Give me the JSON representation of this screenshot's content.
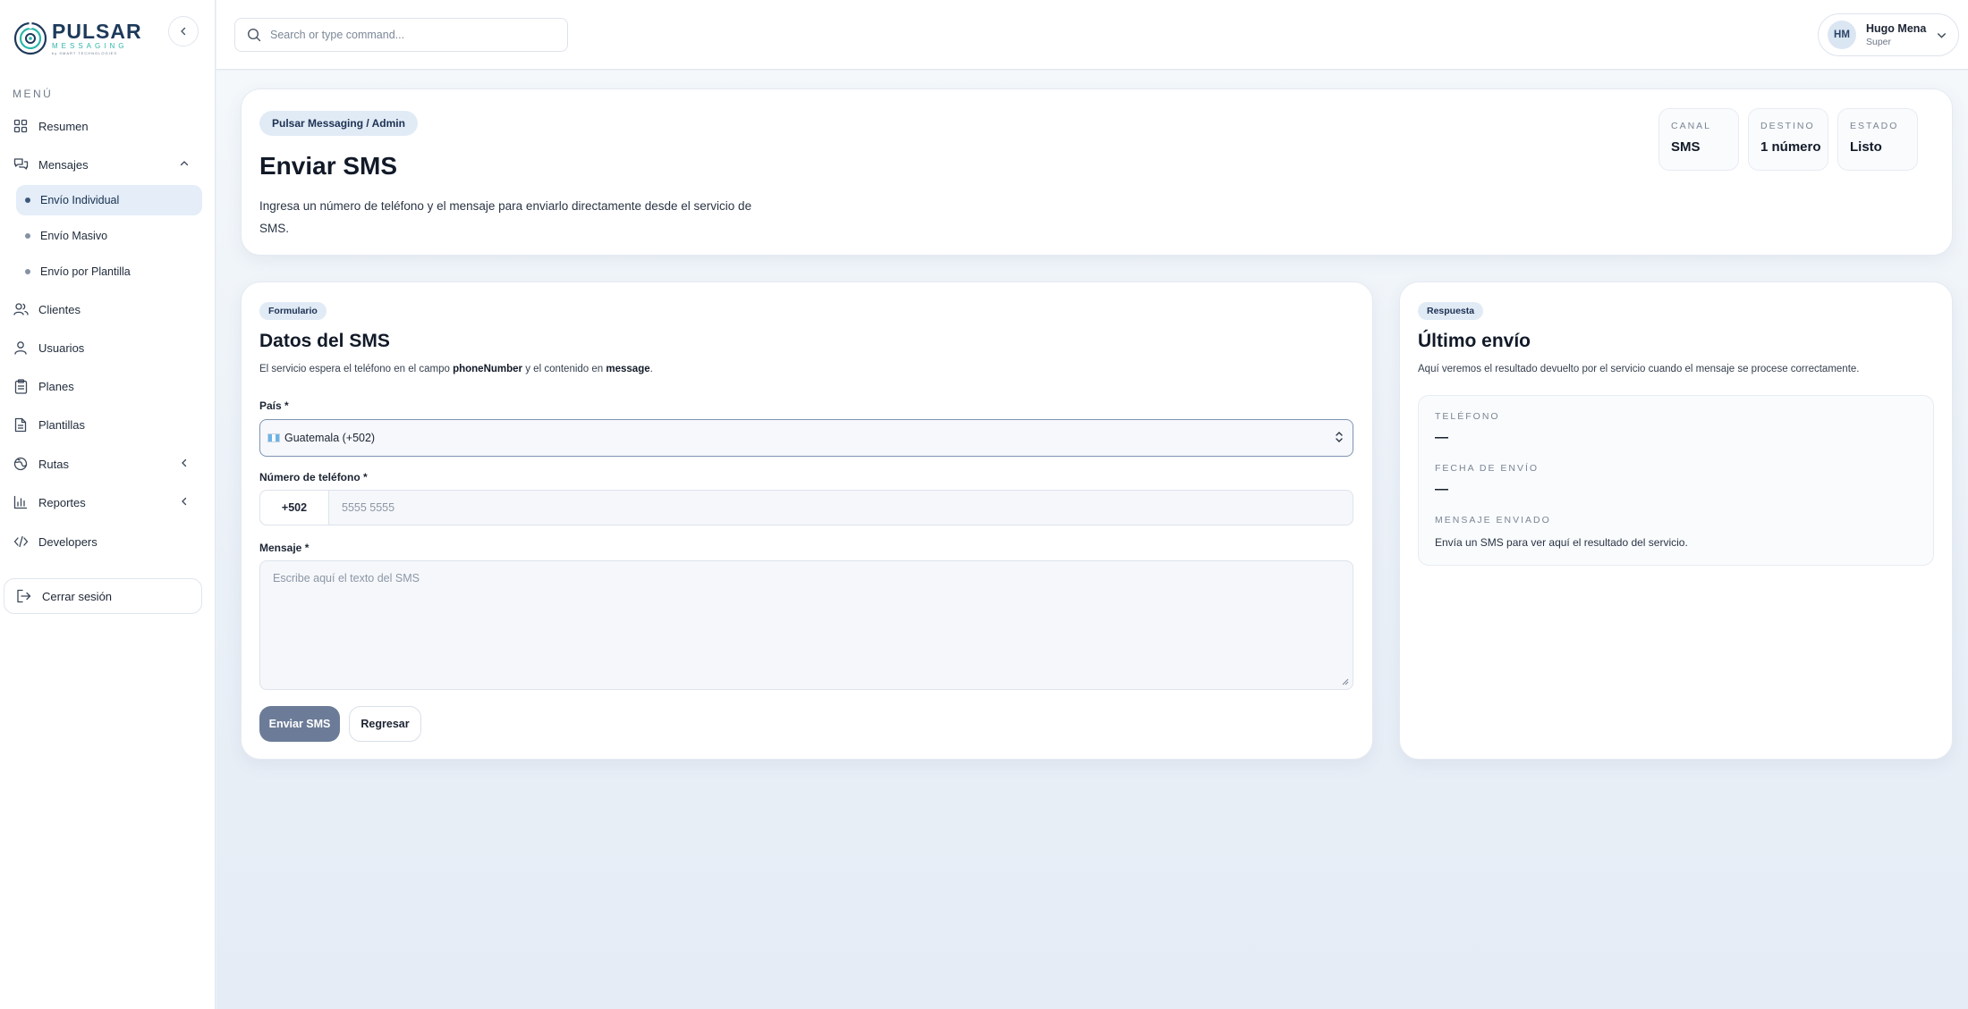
{
  "brand": {
    "name": "PULSAR",
    "subtitle": "MESSAGING",
    "tagline": "by SMART TECHNOLOGIES",
    "accent": "#2cb7a8",
    "primary": "#1d3a5a"
  },
  "sidebar": {
    "menu_label": "MENÚ",
    "items": [
      {
        "label": "Resumen",
        "icon": "grid-icon"
      },
      {
        "label": "Mensajes",
        "icon": "chat-icon",
        "expanded": true
      },
      {
        "label": "Clientes",
        "icon": "users-icon"
      },
      {
        "label": "Usuarios",
        "icon": "user-icon"
      },
      {
        "label": "Planes",
        "icon": "clipboard-icon"
      },
      {
        "label": "Plantillas",
        "icon": "file-icon"
      },
      {
        "label": "Rutas",
        "icon": "globe-icon"
      },
      {
        "label": "Reportes",
        "icon": "bar-chart-icon"
      },
      {
        "label": "Developers",
        "icon": "code-icon"
      }
    ],
    "subitems": [
      {
        "label": "Envío Individual",
        "active": true
      },
      {
        "label": "Envío Masivo"
      },
      {
        "label": "Envío por Plantilla"
      }
    ],
    "logout_label": "Cerrar sesión"
  },
  "topbar": {
    "search_placeholder": "Search or type command...",
    "user": {
      "initials": "HM",
      "name": "Hugo Mena",
      "role": "Super"
    }
  },
  "hero": {
    "breadcrumb": "Pulsar Messaging / Admin",
    "title": "Enviar SMS",
    "description": "Ingresa un número de teléfono y el mensaje para enviarlo directamente desde el servicio de SMS.",
    "stats": [
      {
        "label": "CANAL",
        "value": "SMS"
      },
      {
        "label": "DESTINO",
        "value": "1 número"
      },
      {
        "label": "ESTADO",
        "value": "Listo"
      }
    ]
  },
  "form": {
    "badge": "Formulario",
    "title": "Datos del SMS",
    "desc_prefix": "El servicio espera el teléfono en el campo",
    "desc_field1": "phoneNumber",
    "desc_middle": "y el contenido en",
    "desc_field2": "message",
    "desc_suffix": ".",
    "country_label": "País *",
    "country_value": "Guatemala (+502)",
    "phone_label": "Número de teléfono *",
    "phone_prefix": "+502",
    "phone_placeholder": "5555 5555",
    "message_label": "Mensaje *",
    "message_placeholder": "Escribe aquí el texto del SMS",
    "submit_label": "Enviar SMS",
    "back_label": "Regresar",
    "submit_color": "#6c7c98"
  },
  "response": {
    "badge": "Respuesta",
    "title": "Último envío",
    "description": "Aquí veremos el resultado devuelto por el servicio cuando el mensaje se procese correctamente.",
    "phone_label": "TELÉFONO",
    "phone_value": "—",
    "date_label": "FECHA DE ENVÍO",
    "date_value": "—",
    "message_label": "MENSAJE ENVIADO",
    "message_value": "Envía un SMS para ver aquí el resultado del servicio."
  }
}
